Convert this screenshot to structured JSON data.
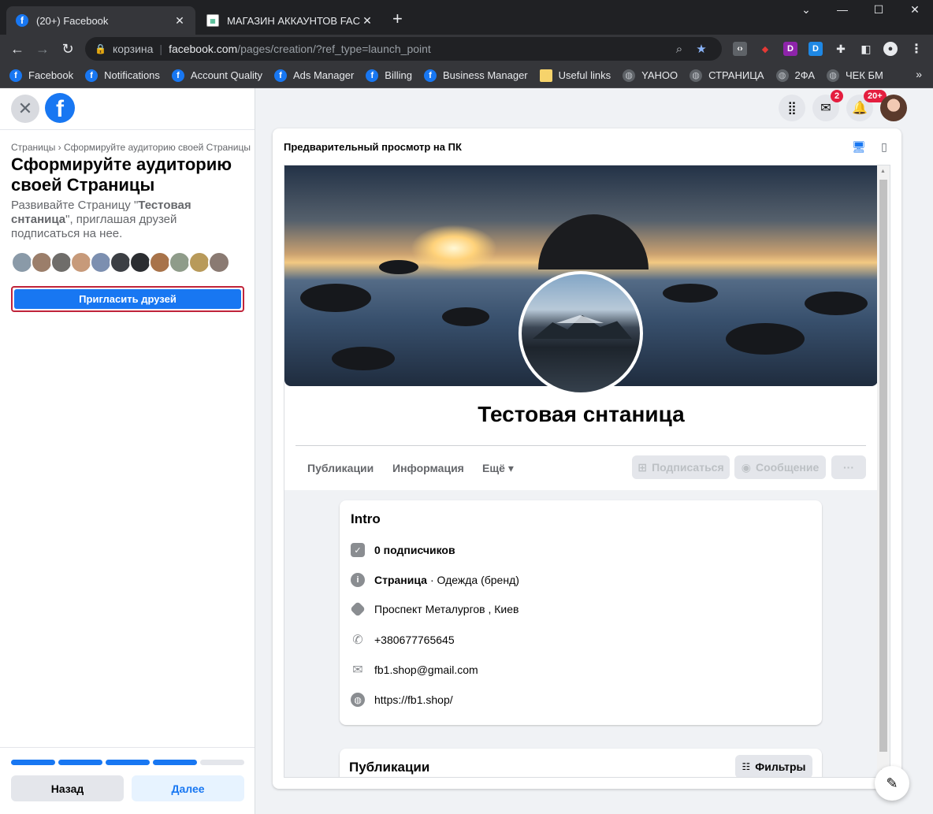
{
  "browser": {
    "tabs": [
      {
        "title": "(20+) Facebook",
        "active": true
      },
      {
        "title": "МАГАЗИН АККАУНТОВ FACEBOOK",
        "active": false
      }
    ],
    "address": {
      "site_chip": "корзина",
      "host": "facebook.com",
      "path": "/pages/creation/?ref_type=launch_point"
    },
    "bookmarks": [
      {
        "label": "Facebook",
        "icon": "facebook-icon"
      },
      {
        "label": "Notifications",
        "icon": "facebook-icon"
      },
      {
        "label": "Account Quality",
        "icon": "facebook-icon"
      },
      {
        "label": "Ads Manager",
        "icon": "facebook-icon"
      },
      {
        "label": "Billing",
        "icon": "facebook-icon"
      },
      {
        "label": "Business Manager",
        "icon": "facebook-icon"
      },
      {
        "label": "Useful links",
        "icon": "folder-icon"
      },
      {
        "label": "YAHOO",
        "icon": "globe-icon"
      },
      {
        "label": "СТРАНИЦА",
        "icon": "globe-icon"
      },
      {
        "label": "2ФА",
        "icon": "globe-icon"
      },
      {
        "label": "ЧЕК БМ",
        "icon": "globe-icon"
      }
    ],
    "bookmarks_more": "»"
  },
  "left": {
    "breadcrumb": "Страницы › Сформируйте аудиторию своей Страницы",
    "title": "Сформируйте аудиторию своей Страницы",
    "desc_prefix": "Развивайте Страницу \"",
    "desc_page": "Тестовая снтаница",
    "desc_suffix": "\", приглашая друзей подписаться на нее.",
    "invite_label": "Пригласить друзей",
    "progress": {
      "steps": 5,
      "completed": 4
    },
    "back_label": "Назад",
    "next_label": "Далее",
    "colors": {
      "accent": "#1877f2",
      "invite_outline": "#c0243a"
    }
  },
  "header": {
    "messenger_badge": "2",
    "notifications_badge": "20+"
  },
  "preview": {
    "title": "Предварительный просмотр на ПК",
    "page_name": "Тестовая снтаница",
    "tabs": [
      "Публикации",
      "Информация",
      "Ещё ▾"
    ],
    "follow_label": "Подписаться",
    "message_label": "Сообщение",
    "more_label": "···",
    "intro": {
      "title": "Intro",
      "followers": "0 подписчиков",
      "category_label": "Страница",
      "category_value": " · Одежда (бренд)",
      "address": "Проспект Металургов , Киев",
      "phone": "+380677765645",
      "email": "fb1.shop@gmail.com",
      "website": "https://fb1.shop/"
    },
    "posts_title": "Публикации",
    "filters_label": "Фильтры"
  }
}
